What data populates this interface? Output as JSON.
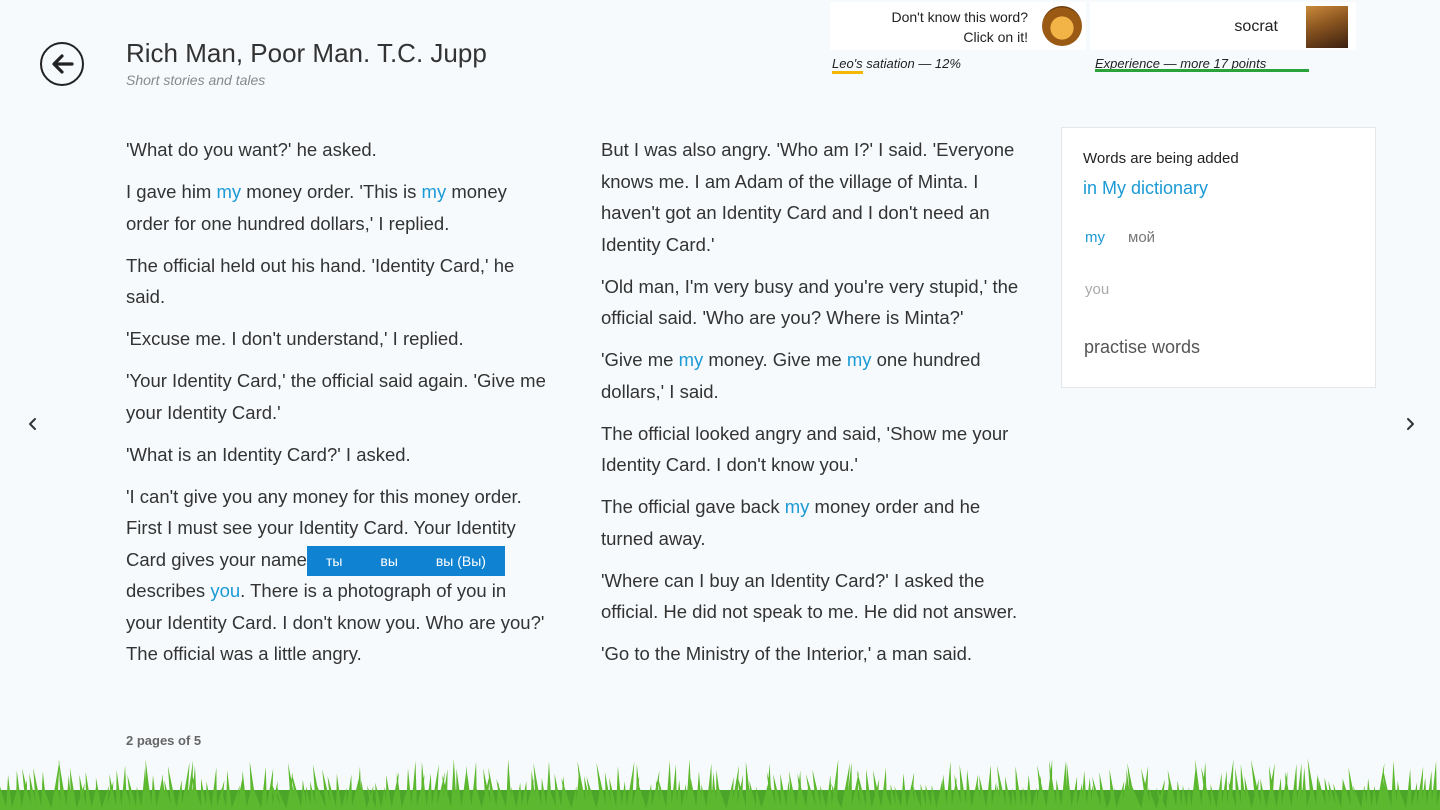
{
  "header": {
    "title": "Rich Man, Poor Man. T.C. Jupp",
    "subtitle": "Short stories and tales",
    "hint_line1": "Don't know this word?",
    "hint_line2": "Click on it!",
    "username": "socrat",
    "leo_satiation": "Leo's satiation — 12%",
    "leo_satiation_level": 0.12,
    "experience": "Experience — more 17 points"
  },
  "page": {
    "left_column": [
      [
        {
          "t": "'What do you want?' he asked."
        }
      ],
      [
        {
          "t": "I gave him "
        },
        {
          "t": "my",
          "hl": true
        },
        {
          "t": " money order. 'This is "
        },
        {
          "t": "my",
          "hl": true
        },
        {
          "t": " money order for one hundred dollars,' I replied."
        }
      ],
      [
        {
          "t": "The official held out his hand. 'Identity Card,' he said."
        }
      ],
      [
        {
          "t": "'Excuse me. I don't understand,' I replied."
        }
      ],
      [
        {
          "t": "'Your Identity Card,' the official said again. 'Give me your Identity Card.'"
        }
      ],
      [
        {
          "t": "'What is an Identity Card?' I asked."
        }
      ],
      [
        {
          "t": "'I can't give you any money for this money order. First I must see your Identity Card. Your Identity Card gives your name. Your Identity Card describes "
        },
        {
          "t": "you",
          "hl": true
        },
        {
          "t": ". There is a photograph of you in your Identity Card. I don't know you. Who are you?' The official was a little angry."
        }
      ]
    ],
    "right_column": [
      [
        {
          "t": "But I was also angry. 'Who am I?' I said. 'Everyone knows me. I am Adam of the village of Minta. I haven't got an Identity Card and I don't need an Identity Card.'"
        }
      ],
      [
        {
          "t": "'Old man, I'm very busy and you're very stupid,' the official said. 'Who are you? Where is Minta?'"
        }
      ],
      [
        {
          "t": "'Give me "
        },
        {
          "t": "my",
          "hl": true
        },
        {
          "t": " money. Give me "
        },
        {
          "t": "my",
          "hl": true
        },
        {
          "t": " one hundred dollars,' I said."
        }
      ],
      [
        {
          "t": "The official looked angry and said, 'Show me your Identity Card. I don't know you.'"
        }
      ],
      [
        {
          "t": "The official gave back "
        },
        {
          "t": "my",
          "hl": true
        },
        {
          "t": " money order and he turned away."
        }
      ],
      [
        {
          "t": "'Where can I buy an Identity Card?' I asked the official. He did not speak to me. He did not answer."
        }
      ],
      [
        {
          "t": "'Go to the Ministry of the Interior,' a man said."
        }
      ]
    ],
    "page_indicator": "2  pages of  5"
  },
  "popup": {
    "options": [
      "ты",
      "вы",
      "вы (Вы)"
    ]
  },
  "dictionary_panel": {
    "heading": "Words are being added",
    "link": "in My dictionary",
    "word1": "my",
    "word1_translation": "мой",
    "word2": "you",
    "practise": "practise words"
  },
  "colors": {
    "highlight": "#1b9ad6",
    "popup_bg": "#0f82d2",
    "satiation_bar": "#f5b800",
    "experience_bar": "#2aa43a",
    "grass": "#5cb82e"
  },
  "icons": {
    "back": "arrow-left-circle-icon",
    "prev": "chevron-left-icon",
    "next": "chevron-right-icon"
  }
}
